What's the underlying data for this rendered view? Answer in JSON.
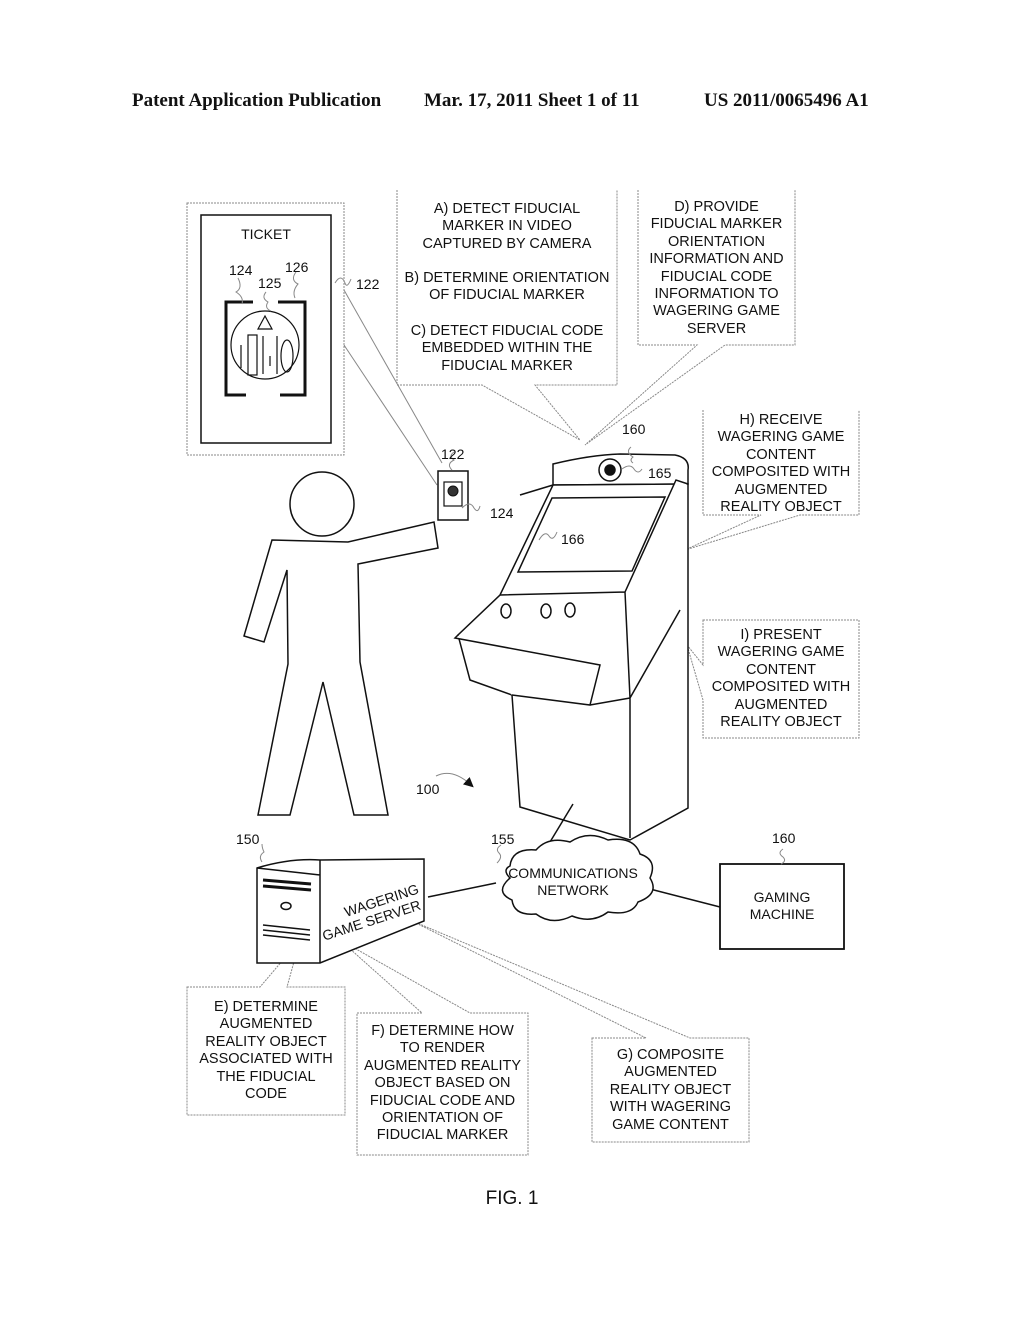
{
  "header": {
    "publication": "Patent Application Publication",
    "date_sheet": "Mar. 17, 2011  Sheet 1 of 11",
    "number": "US 2011/0065496 A1"
  },
  "figure": {
    "caption": "FIG. 1",
    "system_ref": "100",
    "ticket": {
      "title": "TICKET",
      "ref_callout": "122",
      "refs": {
        "marker": "124",
        "symbol": "125",
        "code": "126"
      }
    },
    "handheld_ticket": {
      "ref": "122",
      "marker_ref": "124"
    },
    "gaming_machine": {
      "ref": "160",
      "camera_ref": "165",
      "display_ref": "166"
    },
    "server": {
      "ref": "150",
      "label_line1": "WAGERING",
      "label_line2": "GAME SERVER"
    },
    "network": {
      "ref": "155",
      "label_line1": "COMMUNICATIONS",
      "label_line2": "NETWORK"
    },
    "gaming_machine_box": {
      "ref": "160",
      "label_line1": "GAMING",
      "label_line2": "MACHINE"
    },
    "steps": {
      "a": [
        "A) DETECT FIDUCIAL",
        "MARKER IN VIDEO",
        "CAPTURED BY CAMERA"
      ],
      "b": [
        "B) DETERMINE ORIENTATION",
        "OF FIDUCIAL MARKER"
      ],
      "c": [
        "C) DETECT FIDUCIAL CODE",
        "EMBEDDED WITHIN THE",
        "FIDUCIAL MARKER"
      ],
      "d": [
        "D) PROVIDE",
        "FIDUCIAL MARKER",
        "ORIENTATION",
        "INFORMATION AND",
        "FIDUCIAL CODE",
        "INFORMATION TO",
        "WAGERING GAME",
        "SERVER"
      ],
      "e": [
        "E) DETERMINE",
        "AUGMENTED",
        "REALITY OBJECT",
        "ASSOCIATED WITH",
        "THE FIDUCIAL",
        "CODE"
      ],
      "f": [
        "F) DETERMINE HOW",
        "TO RENDER",
        "AUGMENTED REALITY",
        "OBJECT BASED ON",
        "FIDUCIAL CODE AND",
        "ORIENTATION OF",
        "FIDUCIAL MARKER"
      ],
      "g": [
        "G) COMPOSITE",
        "AUGMENTED",
        "REALITY OBJECT",
        "WITH WAGERING",
        "GAME CONTENT"
      ],
      "h": [
        "H) RECEIVE",
        "WAGERING GAME",
        "CONTENT",
        "COMPOSITED WITH",
        "AUGMENTED",
        "REALITY OBJECT"
      ],
      "i": [
        "I) PRESENT",
        "WAGERING GAME",
        "CONTENT",
        "COMPOSITED WITH",
        "AUGMENTED",
        "REALITY OBJECT"
      ]
    }
  }
}
